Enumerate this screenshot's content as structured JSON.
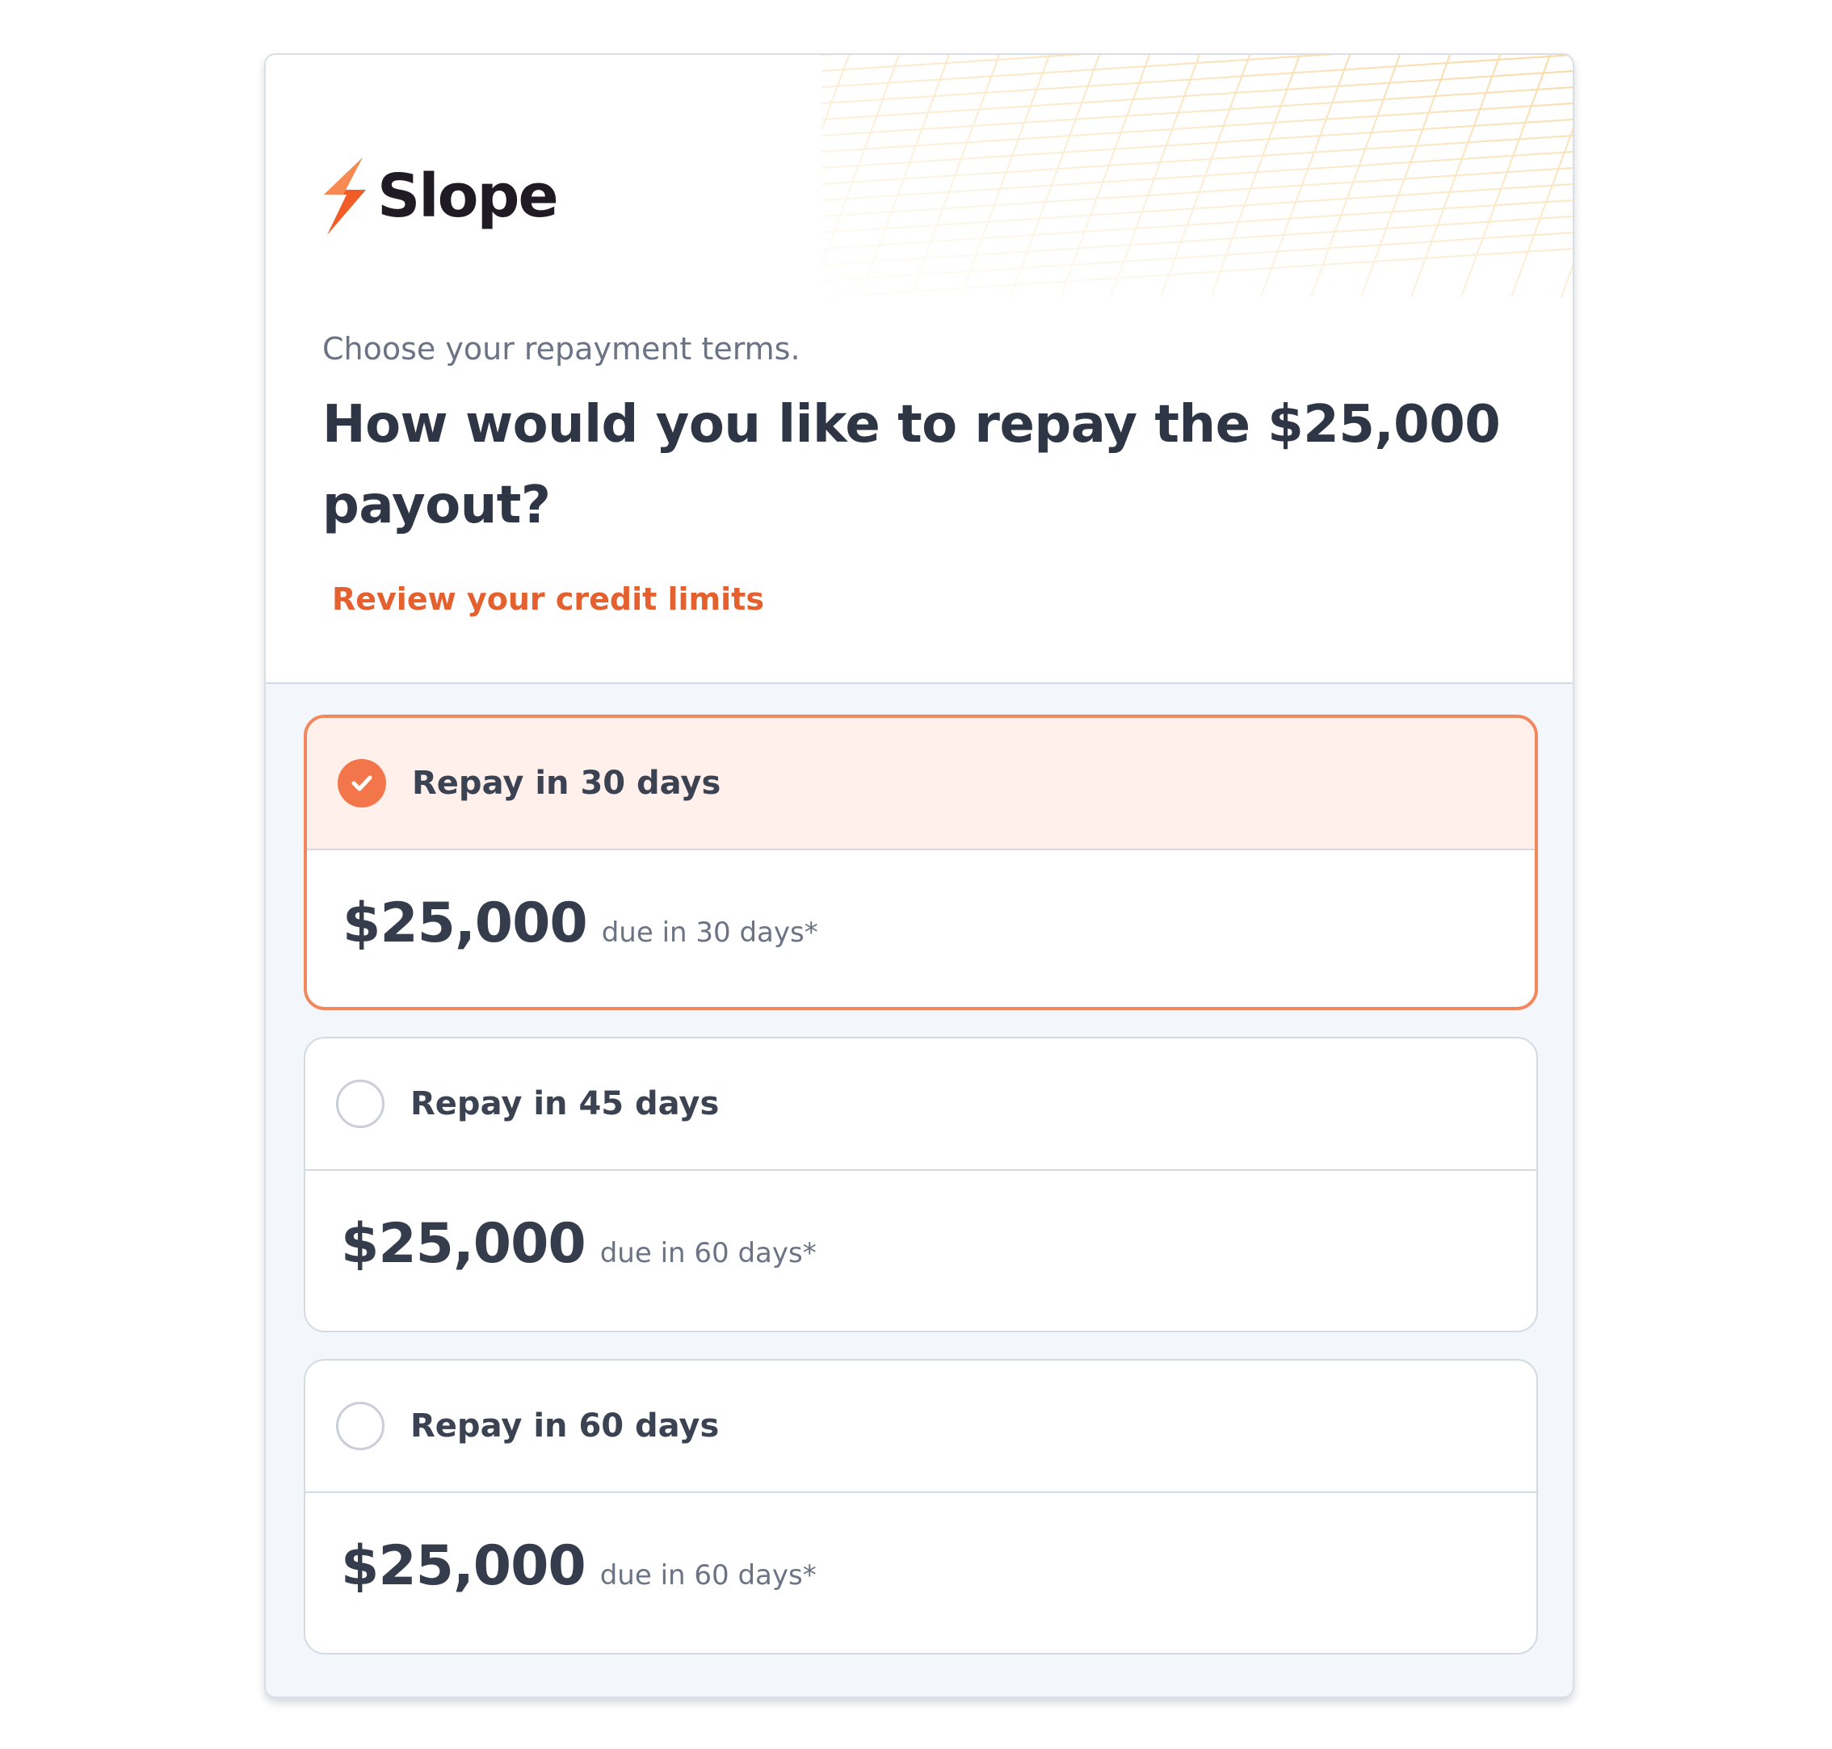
{
  "brand": {
    "name": "Slope",
    "accent_color": "#f26a3c",
    "logo_icon": "lightning-bolt-icon"
  },
  "header": {
    "subtitle": "Choose your repayment terms.",
    "title": "How would you like to repay the $25,000 payout?",
    "link_label": "Review your credit limits",
    "link_color": "#e5602f"
  },
  "options": [
    {
      "label": "Repay in 30 days",
      "amount": "$25,000",
      "due_text": "due in 30 days*",
      "selected": true
    },
    {
      "label": "Repay in 45 days",
      "amount": "$25,000",
      "due_text": "due in 60 days*",
      "selected": false
    },
    {
      "label": "Repay in 60 days",
      "amount": "$25,000",
      "due_text": "due in 60 days*",
      "selected": false
    }
  ]
}
